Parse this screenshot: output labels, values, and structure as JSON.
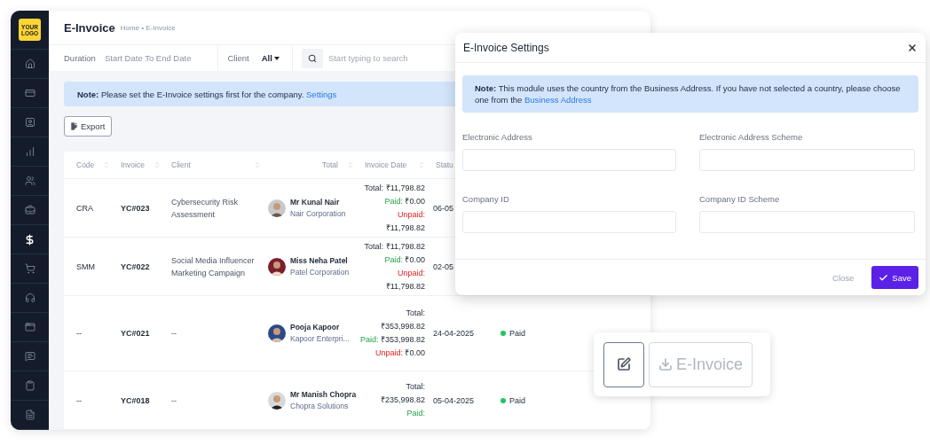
{
  "logo": {
    "text": "YOUR LOGO"
  },
  "sidebar": {
    "items": [
      {
        "selected": false
      },
      {
        "selected": false
      },
      {
        "selected": false
      },
      {
        "selected": false
      },
      {
        "selected": false
      },
      {
        "selected": false
      },
      {
        "selected": true
      },
      {
        "selected": false
      },
      {
        "selected": false
      },
      {
        "selected": false
      },
      {
        "selected": false
      },
      {
        "selected": false
      },
      {
        "selected": false
      }
    ]
  },
  "header": {
    "title": "E-Invoice",
    "breadcrumb": "Home • E-Invoice"
  },
  "filters": {
    "duration_label": "Duration",
    "duration_placeholder": "Start Date To End Date",
    "client_label": "Client",
    "client_value": "All",
    "search_placeholder": "Start typing to search"
  },
  "note": {
    "text": "**Note:** Please set the E-Invoice settings first for the company.",
    "link": "Settings"
  },
  "export_button": "Export",
  "table": {
    "columns": [
      "Code",
      "Invoice",
      "Client",
      "Total",
      "Invoice Date",
      "Statu"
    ],
    "rows": [
      {
        "code": "CRA",
        "invoice": "YC#023",
        "project": "Cybersecurity Risk Assessment",
        "client": "Mr Kunal Nair",
        "company": "Nair Corporation",
        "totals": [
          {
            "kind": "total",
            "label": "Total:",
            "amount": "₹11,798.82"
          },
          {
            "kind": "paid",
            "label": "Paid:",
            "amount": "₹0.00"
          },
          {
            "kind": "unpaid",
            "label": "Unpaid:",
            "amount": "₹11,798.82"
          }
        ],
        "date": "06-05"
      },
      {
        "code": "SMM",
        "invoice": "YC#022",
        "project": "Social Media Influencer Marketing Campaign",
        "client": "Miss Neha Patel",
        "company": "Patel Corporation",
        "totals": [
          {
            "kind": "total",
            "label": "Total:",
            "amount": "₹11,798.82"
          },
          {
            "kind": "paid",
            "label": "Paid:",
            "amount": "₹0.00"
          },
          {
            "kind": "unpaid",
            "label": "Unpaid:",
            "amount": "₹11,798.82"
          }
        ],
        "date": "02-05"
      },
      {
        "code": "--",
        "invoice": "YC#021",
        "project": "--",
        "client": "Pooja Kapoor",
        "company": "Kapoor Enterpri...",
        "totals": [
          {
            "kind": "total",
            "label": "Total:",
            "amount": "₹353,998.82"
          },
          {
            "kind": "paid",
            "label": "Paid:",
            "amount": "₹353,998.82"
          },
          {
            "kind": "unpaid",
            "label": "Unpaid:",
            "amount": "₹0.00"
          }
        ],
        "date": "24-04-2025",
        "status": {
          "label": "Paid",
          "color": "#22c55e"
        }
      },
      {
        "code": "--",
        "invoice": "YC#018",
        "project": "--",
        "client": "Mr Manish Chopra",
        "company": "Chopra Solutions",
        "totals": [
          {
            "kind": "total",
            "label": "Total:",
            "amount": "₹235,998.82"
          },
          {
            "kind": "paid",
            "label": "Paid:"
          }
        ],
        "date": "05-04-2025",
        "status": {
          "label": "Paid",
          "color": "#22c55e"
        }
      }
    ]
  },
  "modal": {
    "title": "E-Invoice Settings",
    "note": "**Note:** This module uses the country from the Business Address. If you have not selected a country, please choose one from the",
    "note_link": "Business Address",
    "fields": [
      {
        "label": "Electronic Address"
      },
      {
        "label": "Electronic Address Scheme"
      },
      {
        "label": "Company ID"
      },
      {
        "label": "Company ID Scheme"
      }
    ],
    "close_button": "Close",
    "save_button": "Save"
  },
  "action_card": {
    "buttons": [
      {
        "kind": "icon",
        "disabled": false
      },
      {
        "kind": "text",
        "label": "E-Invoice",
        "disabled": true
      }
    ]
  }
}
